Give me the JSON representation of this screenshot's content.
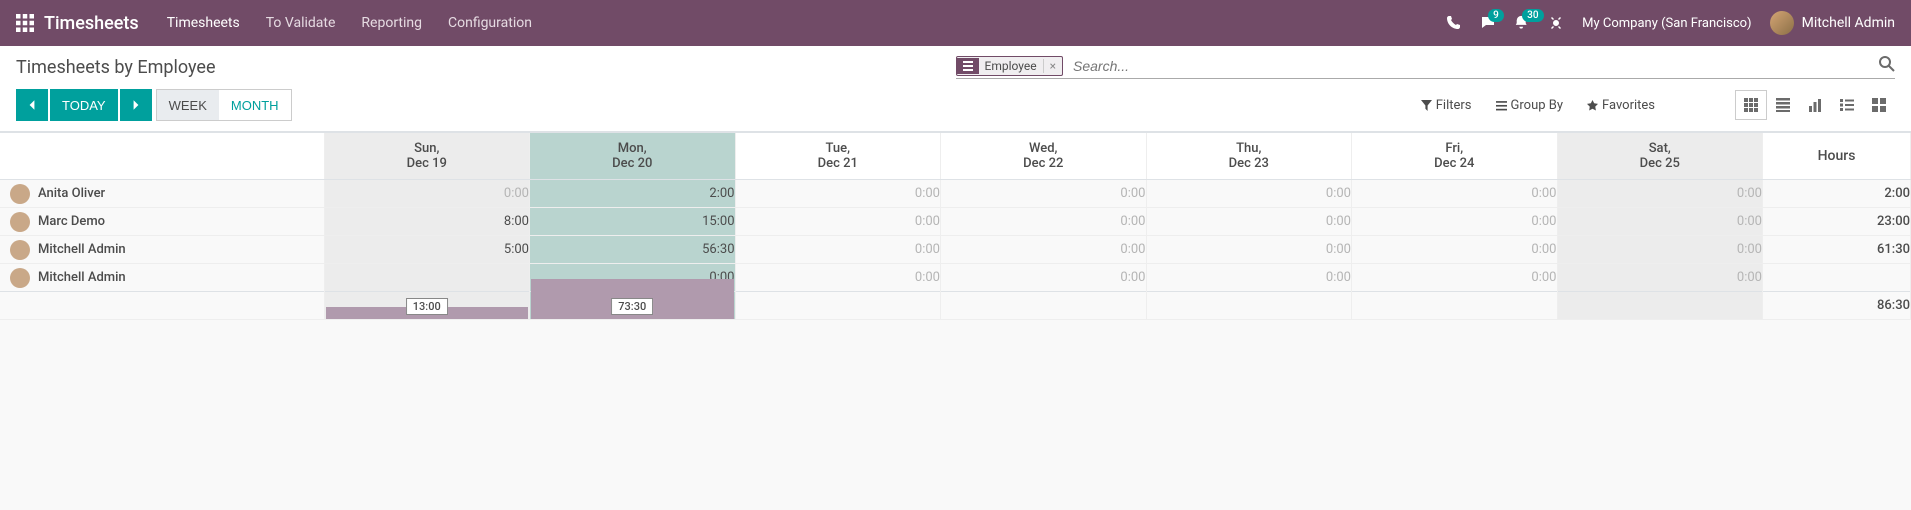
{
  "nav": {
    "brand": "Timesheets",
    "menu": [
      "Timesheets",
      "To Validate",
      "Reporting",
      "Configuration"
    ],
    "chat_badge": "9",
    "activity_badge": "30",
    "company": "My Company (San Francisco)",
    "user": "Mitchell Admin"
  },
  "cp": {
    "title": "Timesheets by Employee",
    "facet_label": "Employee",
    "search_placeholder": "Search...",
    "today": "TODAY",
    "week": "WEEK",
    "month": "MONTH",
    "filters": "Filters",
    "groupby": "Group By",
    "favorites": "Favorites"
  },
  "grid": {
    "days": [
      {
        "dow": "Sun,",
        "dom": "Dec 19",
        "cls": "wk-sun"
      },
      {
        "dow": "Mon,",
        "dom": "Dec 20",
        "cls": "wk-today"
      },
      {
        "dow": "Tue,",
        "dom": "Dec 21",
        "cls": ""
      },
      {
        "dow": "Wed,",
        "dom": "Dec 22",
        "cls": ""
      },
      {
        "dow": "Thu,",
        "dom": "Dec 23",
        "cls": ""
      },
      {
        "dow": "Fri,",
        "dom": "Dec 24",
        "cls": ""
      },
      {
        "dow": "Sat,",
        "dom": "Dec 25",
        "cls": "wk-sat"
      }
    ],
    "total_col": "Hours",
    "rows": [
      {
        "name": "Anita Oliver",
        "vals": [
          "0:00",
          "2:00",
          "0:00",
          "0:00",
          "0:00",
          "0:00",
          "0:00"
        ],
        "muted": [
          true,
          false,
          true,
          true,
          true,
          true,
          true
        ],
        "total": "2:00"
      },
      {
        "name": "Marc Demo",
        "vals": [
          "8:00",
          "15:00",
          "0:00",
          "0:00",
          "0:00",
          "0:00",
          "0:00"
        ],
        "muted": [
          false,
          false,
          true,
          true,
          true,
          true,
          true
        ],
        "total": "23:00"
      },
      {
        "name": "Mitchell Admin",
        "vals": [
          "5:00",
          "56:30",
          "0:00",
          "0:00",
          "0:00",
          "0:00",
          "0:00"
        ],
        "muted": [
          false,
          false,
          true,
          true,
          true,
          true,
          true
        ],
        "total": "61:30"
      },
      {
        "name": "Mitchell Admin",
        "vals": [
          "",
          "0:00",
          "0:00",
          "0:00",
          "0:00",
          "0:00",
          "0:00"
        ],
        "muted": [
          true,
          false,
          true,
          true,
          true,
          true,
          true
        ],
        "total": ""
      }
    ],
    "col_totals": [
      "13:00",
      "73:30",
      "",
      "",
      "",
      "",
      ""
    ],
    "col_bar_heights": [
      12,
      40,
      0,
      0,
      0,
      0,
      0
    ],
    "grand_total": "86:30"
  },
  "colors": {
    "brand": "#714B67",
    "teal": "#00A09D"
  }
}
